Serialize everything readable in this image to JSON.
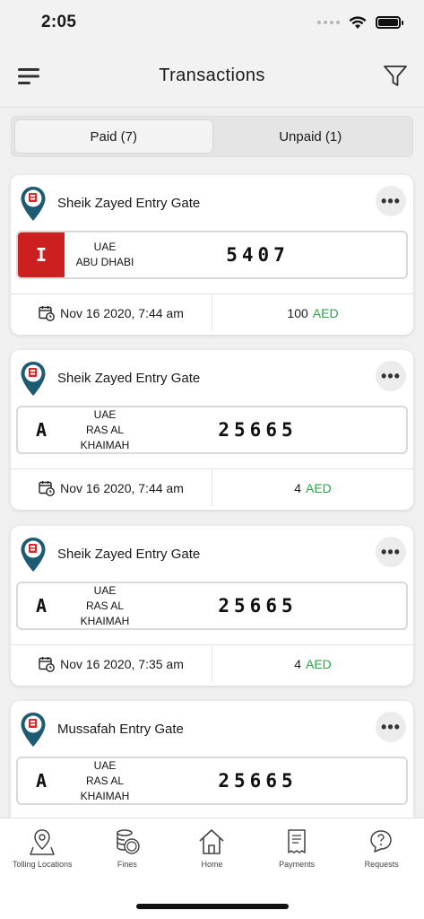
{
  "status": {
    "time": "2:05"
  },
  "header": {
    "title": "Transactions"
  },
  "tabs": [
    {
      "label": "Paid (7)",
      "active": true
    },
    {
      "label": "Unpaid (1)",
      "active": false
    }
  ],
  "transactions": [
    {
      "gate": "Sheik Zayed Entry Gate",
      "plate_code": "I",
      "plate_country": "UAE",
      "plate_emirate_line1": "ABU DHABI",
      "plate_emirate_line2": "",
      "plate_number": "5407",
      "datetime": "Nov 16 2020, 7:44 am",
      "amount": "100",
      "currency": "AED",
      "code_style": "red"
    },
    {
      "gate": "Sheik Zayed Entry Gate",
      "plate_code": "A",
      "plate_country": "UAE",
      "plate_emirate_line1": "RAS AL",
      "plate_emirate_line2": "KHAIMAH",
      "plate_number": "25665",
      "datetime": "Nov 16 2020, 7:44 am",
      "amount": "4",
      "currency": "AED",
      "code_style": "plain"
    },
    {
      "gate": "Sheik Zayed Entry Gate",
      "plate_code": "A",
      "plate_country": "UAE",
      "plate_emirate_line1": "RAS AL",
      "plate_emirate_line2": "KHAIMAH",
      "plate_number": "25665",
      "datetime": "Nov 16 2020, 7:35 am",
      "amount": "4",
      "currency": "AED",
      "code_style": "plain"
    },
    {
      "gate": "Mussafah Entry Gate",
      "plate_code": "A",
      "plate_country": "UAE",
      "plate_emirate_line1": "RAS AL",
      "plate_emirate_line2": "KHAIMAH",
      "plate_number": "25665",
      "datetime": "",
      "amount": "",
      "currency": "",
      "code_style": "plain"
    }
  ],
  "nav": [
    {
      "label": "Tolling Locations",
      "icon": "map-pin-icon"
    },
    {
      "label": "Fines",
      "icon": "coins-icon"
    },
    {
      "label": "Home",
      "icon": "home-icon"
    },
    {
      "label": "Payments",
      "icon": "receipt-icon"
    },
    {
      "label": "Requests",
      "icon": "help-chat-icon"
    }
  ],
  "colors": {
    "accent": "#2aa54a",
    "plate_red": "#cc1f1f",
    "pin_blue": "#1d5b73",
    "pin_red": "#d8262b"
  }
}
